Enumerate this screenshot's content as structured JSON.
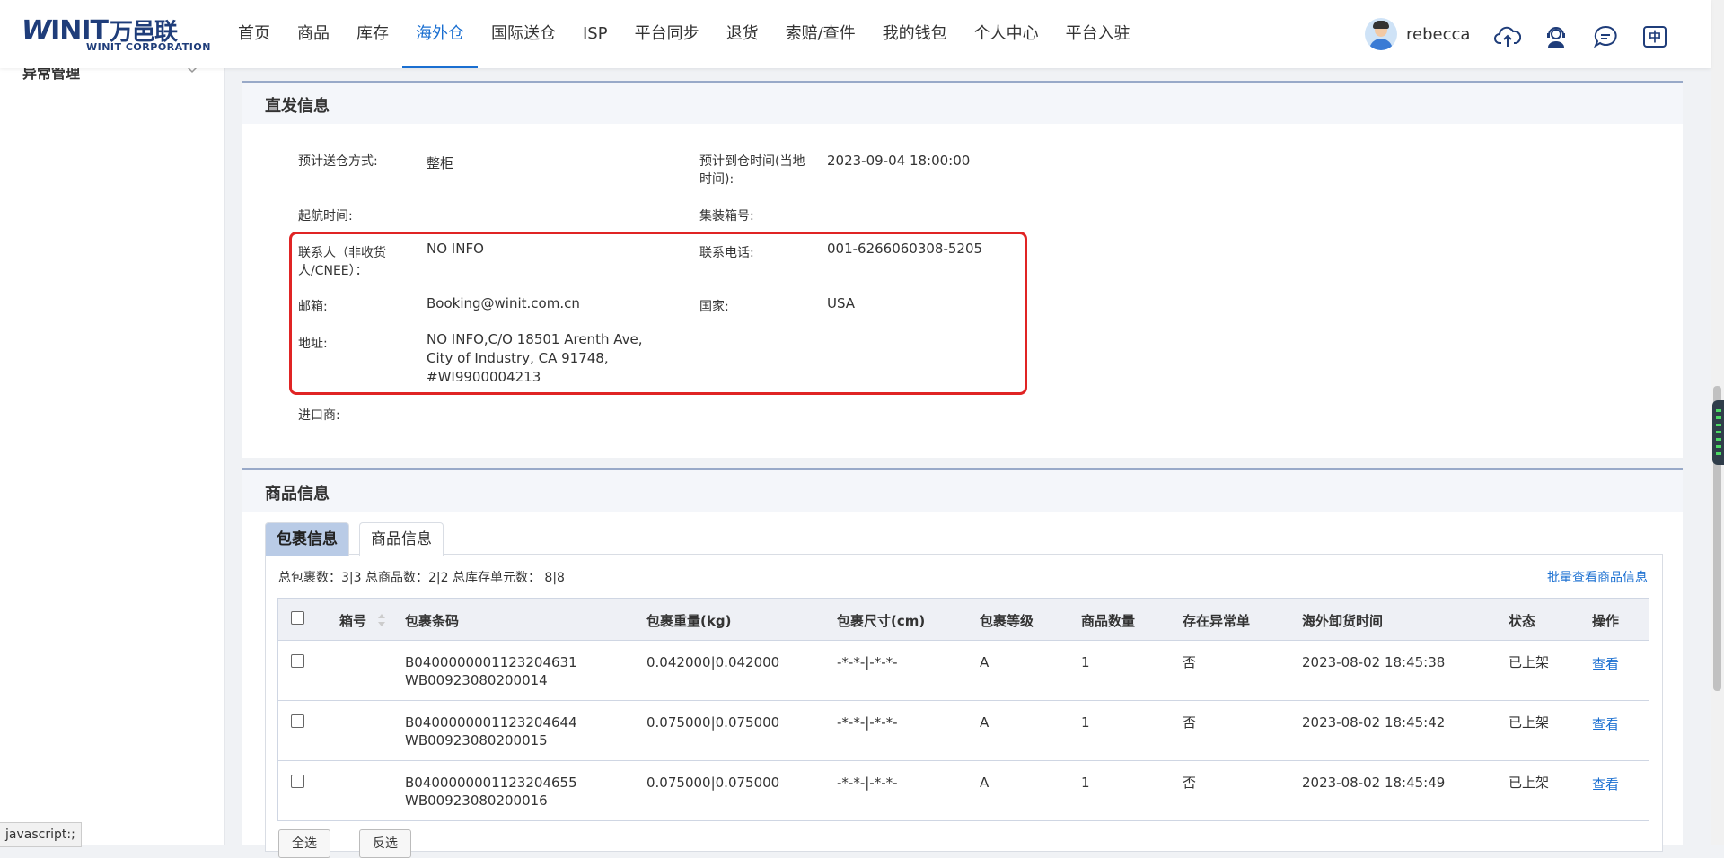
{
  "header": {
    "logo_main": "INIT",
    "logo_w": "W",
    "logo_cn": "万邑联",
    "logo_sub": "WINIT CORPORATION",
    "nav": [
      "首页",
      "商品",
      "库存",
      "海外仓",
      "国际送仓",
      "ISP",
      "平台同步",
      "退货",
      "索赔/查件",
      "我的钱包",
      "个人中心",
      "平台入驻"
    ],
    "active_nav": "海外仓",
    "username": "rebecca",
    "lang_label": "中",
    "icons": [
      "upload-cloud-icon",
      "support-agent-icon",
      "chat-icon",
      "language-icon"
    ]
  },
  "sidebar": {
    "item_label": "异常管理"
  },
  "direct_info": {
    "title": "直发信息",
    "delivery_method_label": "预计送仓方式:",
    "delivery_method_value": "整柜",
    "arrival_time_label_1": "预计到仓时间(当地",
    "arrival_time_label_2": "时间):",
    "arrival_time_value": "2023-09-04 18:00:00",
    "sail_time_label": "起航时间:",
    "container_no_label": "集装箱号:",
    "contact_label_1": "联系人（非收货",
    "contact_label_2": "人/CNEE）：",
    "contact_value": "NO INFO",
    "phone_label": "联系电话:",
    "phone_value": "001-6266060308-5205",
    "email_label": "邮箱:",
    "email_value": "Booking@winit.com.cn",
    "country_label": "国家:",
    "country_value": "USA",
    "address_label": "地址:",
    "address_line1": "NO INFO,C/O 18501 Arenth Ave,",
    "address_line2": "City of Industry, CA 91748,",
    "address_line3": "#WI9900004213",
    "importer_label": "进口商:"
  },
  "product_info": {
    "title": "商品信息",
    "tabs": [
      "包裹信息",
      "商品信息"
    ],
    "active_tab": "包裹信息",
    "summary": "总包裹数：3|3 总商品数：2|2 总库存单元数： 8|8",
    "batch_link": "批量查看商品信息",
    "columns": [
      "箱号",
      "包裹条码",
      "包裹重量(kg)",
      "包裹尺寸(cm)",
      "包裹等级",
      "商品数量",
      "存在异常单",
      "海外卸货时间",
      "状态",
      "操作"
    ],
    "rows": [
      {
        "barcode1": "B0400000001123204631",
        "barcode2": "WB00923080200014",
        "weight": "0.042000|0.042000",
        "size": "-*-*-|-*-*-",
        "grade": "A",
        "qty": "1",
        "abnormal": "否",
        "unload_time": "2023-08-02 18:45:38",
        "status": "已上架",
        "action": "查看"
      },
      {
        "barcode1": "B0400000001123204644",
        "barcode2": "WB00923080200015",
        "weight": "0.075000|0.075000",
        "size": "-*-*-|-*-*-",
        "grade": "A",
        "qty": "1",
        "abnormal": "否",
        "unload_time": "2023-08-02 18:45:42",
        "status": "已上架",
        "action": "查看"
      },
      {
        "barcode1": "B0400000001123204655",
        "barcode2": "WB00923080200016",
        "weight": "0.075000|0.075000",
        "size": "-*-*-|-*-*-",
        "grade": "A",
        "qty": "1",
        "abnormal": "否",
        "unload_time": "2023-08-02 18:45:49",
        "status": "已上架",
        "action": "查看"
      }
    ],
    "select_all_label": "全选",
    "invert_label": "反选"
  },
  "status_bar": "javascript:;",
  "colors": {
    "accent": "#1a6fd1",
    "highlight_border": "#e02424",
    "brand": "#1f3d7a"
  }
}
